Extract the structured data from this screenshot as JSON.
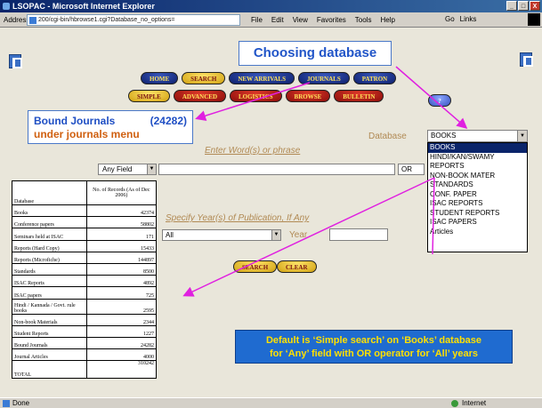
{
  "window": {
    "title": "LSOPAC - Microsoft Internet Explorer",
    "buttons": [
      "_",
      "□",
      "X"
    ]
  },
  "addressbar": {
    "label": "Address",
    "url": "200/cgi-bin/hbrowse1.cgi?Database_no_options=",
    "menu": [
      "File",
      "Edit",
      "View",
      "Favorites",
      "Tools",
      "Help"
    ],
    "tools": [
      "Go",
      "Links"
    ]
  },
  "callouts": {
    "choosing": "Choosing database",
    "bound_title": "Bound Journals",
    "bound_count": "(24282)",
    "bound_sub": "under journals menu",
    "default_line1": "Default is ‘Simple search’ on ‘Books’ database",
    "default_line2": "for ‘Any’ field with OR operator for ‘All’ years"
  },
  "nav_top": [
    "HOME",
    "SEARCH",
    "NEW ARRIVALS",
    "JOURNALS",
    "PATRON"
  ],
  "nav_bottom": [
    "SIMPLE",
    "ADVANCED",
    "LOGISTICS",
    "BROWSE",
    "BULLETIN"
  ],
  "help_label": "?",
  "database": {
    "label": "Database",
    "selected": "BOOKS",
    "options": [
      "BOOKS",
      "HINDI/KAN/SWAMY",
      "REPORTS",
      "NON-BOOK MATER",
      "STANDARDS",
      "CONF. PAPER",
      "ISAC REPORTS",
      "STUDENT REPORTS",
      "ISAC PAPERS",
      "Articles"
    ]
  },
  "search": {
    "phrase_label": "Enter Word(s) or phrase",
    "field_value": "Any Field",
    "operator_value": "OR",
    "year_label": "Specify Year(s) of Publication, If Any",
    "year_select_value": "All",
    "year_text": "Year",
    "search_label": "SEARCH",
    "clear_label": "CLEAR"
  },
  "stats_table": {
    "headers": [
      "Database",
      "No. of Records (As of Dec 2006)"
    ],
    "rows": [
      [
        "Books",
        "42374"
      ],
      [
        "Conference papers",
        "58802"
      ],
      [
        "Seminars held at ISAC",
        "171"
      ],
      [
        "Reports (Hard Copy)",
        "15433"
      ],
      [
        "Reports (Microfiche)",
        "144897"
      ],
      [
        "Standards",
        "8500"
      ],
      [
        "ISAC Reports",
        "4892"
      ],
      [
        "ISAC papers",
        "725"
      ],
      [
        "Hindi / Kannada / Govt. rule books",
        "2595"
      ],
      [
        "Non-book Materials",
        "2344"
      ],
      [
        "Student Reports",
        "1227"
      ],
      [
        "Bound Journals",
        "24282"
      ],
      [
        "Journal Articles",
        "4000"
      ]
    ],
    "total_label": "TOTAL",
    "total_value": "310242"
  },
  "status": {
    "left": "Done",
    "right": "Internet"
  },
  "colors": {
    "callout_blue": "#1f6bd0",
    "callout_yellow": "#ffe000",
    "arrow": "#e020e0",
    "label_tan": "#b18a54"
  }
}
